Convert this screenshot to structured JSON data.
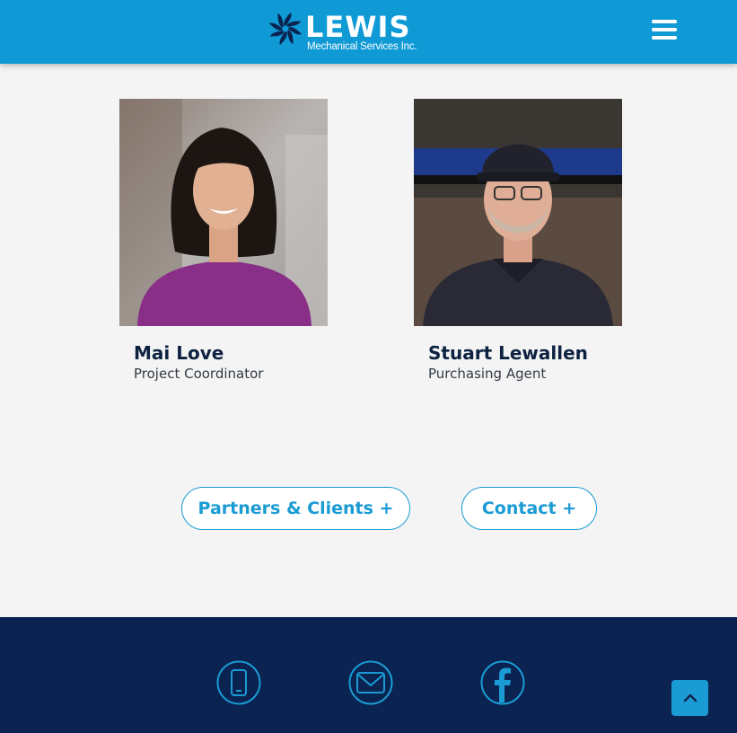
{
  "header": {
    "logo_word": "LEWIS",
    "logo_sub": "Mechanical Services Inc.",
    "menu_icon": "hamburger-icon"
  },
  "team": [
    {
      "name": "Mai Love",
      "title": "Project Coordinator"
    },
    {
      "name": "Stuart Lewallen",
      "title": "Purchasing Agent"
    }
  ],
  "actions": {
    "partners_label": "Partners & Clients +",
    "contact_label": "Contact +"
  },
  "footer": {
    "icons": [
      "phone-icon",
      "mail-icon",
      "facebook-icon"
    ],
    "back_to_top_icon": "chevron-up-icon"
  },
  "colors": {
    "brand_blue": "#0f9ad6",
    "navy": "#0b2350",
    "accent": "#1a9bd4",
    "page_bg": "#f4f4f4"
  }
}
